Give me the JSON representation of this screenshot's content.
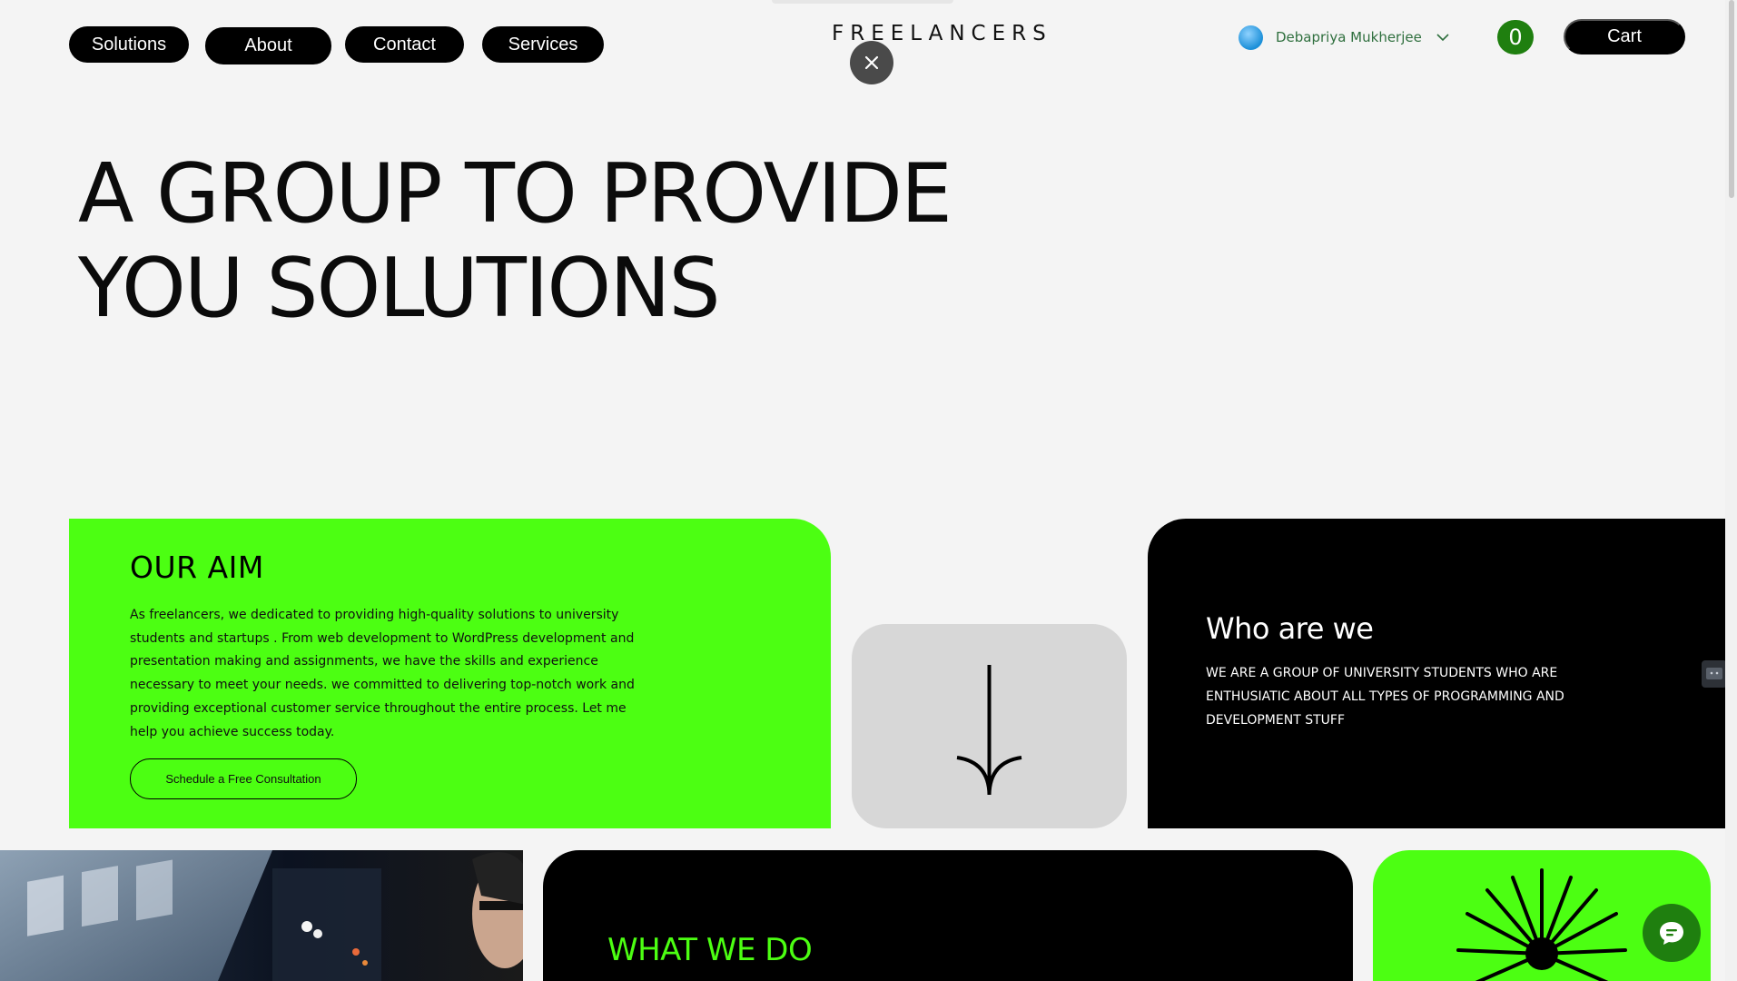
{
  "nav": {
    "solutions": "Solutions",
    "about": "About",
    "contact": "Contact",
    "services": "Services"
  },
  "brand": "FREELANCERS",
  "user": {
    "name": "Debapriya Mukherjee",
    "avatar_icon": "avatar-icon",
    "menu_icon": "chevron-down-icon"
  },
  "cart": {
    "count": "0",
    "label": "Cart"
  },
  "hero": {
    "line1": "A GROUP TO PROVIDE",
    "line2": "YOU SOLUTIONS"
  },
  "aim": {
    "title": "OUR AIM",
    "body": "As  freelancers, we  dedicated to providing high-quality solutions to university students and startups . From web development to WordPress development and presentation making and  assignments, we have the skills and experience necessary to meet your  needs. we  committed to delivering top-notch work and providing exceptional customer service throughout the entire process. Let me help you achieve  success today.",
    "cta": "Schedule a Free Consultation"
  },
  "who": {
    "title": "Who are we",
    "body": "WE ARE A  GROUP OF UNIVERSITY STUDENTS WHO ARE ENTHUSIATIC  ABOUT  ALL TYPES  OF PROGRAMMING AND DEVELOPMENT STUFF"
  },
  "what": {
    "title": "WHAT WE DO"
  },
  "colors": {
    "accent_green": "#4cff12",
    "dark_green": "#1f7f0f",
    "black": "#000000",
    "background": "#f4f4f4"
  }
}
